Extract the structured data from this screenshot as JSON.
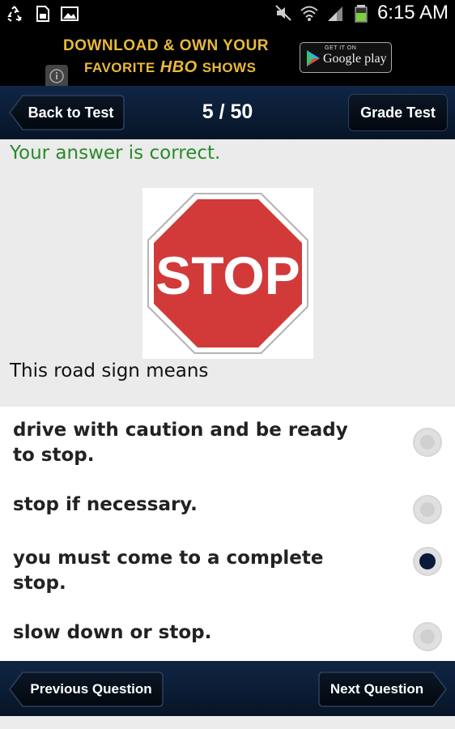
{
  "status_bar": {
    "time": "6:15 AM",
    "icons": [
      "recycle-icon",
      "sd-card-icon",
      "image-icon",
      "mute-icon",
      "wifi-icon",
      "signal-icon",
      "battery-icon"
    ]
  },
  "ad": {
    "line1": "DOWNLOAD & OWN YOUR",
    "line2_before": "FAVORITE",
    "line2_brand": "HBO",
    "line2_after": "SHOWS",
    "badge_small": "GET IT ON",
    "badge_big": "Google play"
  },
  "nav": {
    "back_label": "Back to Test",
    "counter": "5 / 50",
    "grade_label": "Grade Test"
  },
  "result": {
    "message": "Your answer is correct.",
    "color": "#2a8a2a"
  },
  "sign": {
    "text": "STOP",
    "color": "#d23a3a"
  },
  "question": {
    "text": "This road sign means"
  },
  "options": [
    {
      "text": "drive with caution and be ready to stop.",
      "selected": false
    },
    {
      "text": "stop if necessary.",
      "selected": false
    },
    {
      "text": "you must come to a complete stop.",
      "selected": true
    },
    {
      "text": "slow down or stop.",
      "selected": false
    }
  ],
  "footer": {
    "prev_label": "Previous Question",
    "next_label": "Next Question"
  },
  "colors": {
    "nav_bg": "#0a1c36",
    "accent_selected": "#0c1a3a"
  }
}
